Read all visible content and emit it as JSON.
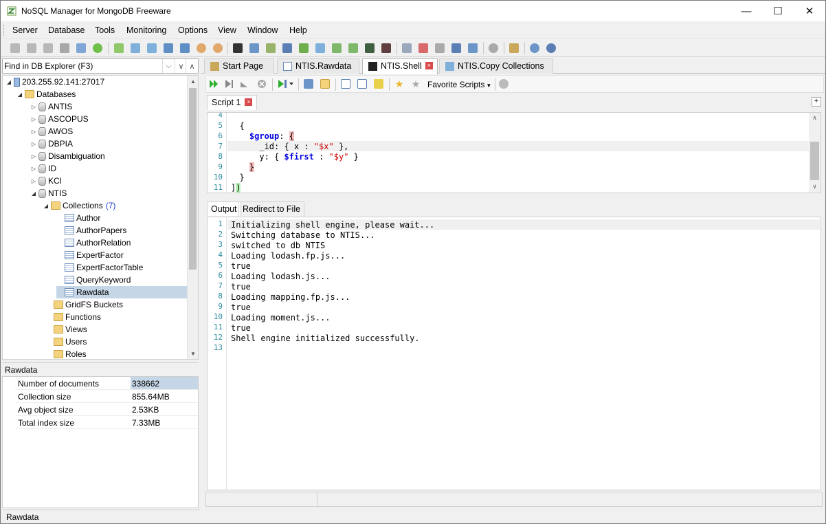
{
  "window": {
    "title": "NoSQL Manager for MongoDB Freeware"
  },
  "menu": [
    "Server",
    "Database",
    "Tools",
    "Monitoring",
    "Options",
    "View",
    "Window",
    "Help"
  ],
  "find": {
    "placeholder": "Find in DB Explorer (F3)"
  },
  "tree": {
    "server": "203.255.92.141:27017",
    "databases_label": "Databases",
    "databases": [
      "ANTIS",
      "ASCOPUS",
      "AWOS",
      "DBPIA",
      "Disambiguation",
      "ID",
      "KCI",
      "NTIS"
    ],
    "collections_label": "Collections",
    "collections_count": "(7)",
    "collections": [
      "Author",
      "AuthorPapers",
      "AuthorRelation",
      "ExpertFactor",
      "ExpertFactorTable",
      "QueryKeyword",
      "Rawdata"
    ],
    "other_folders": [
      "GridFS Buckets",
      "Functions",
      "Views",
      "Users",
      "Roles"
    ]
  },
  "properties": {
    "title": "Rawdata",
    "rows": [
      {
        "key": "Number of documents",
        "value": "338662"
      },
      {
        "key": "Collection size",
        "value": "855.64MB"
      },
      {
        "key": "Avg object size",
        "value": "2.53KB"
      },
      {
        "key": "Total index size",
        "value": "7.33MB"
      }
    ]
  },
  "tabs": [
    "Start Page",
    "NTIS.Rawdata",
    "NTIS.Shell",
    "NTIS.Copy Collections"
  ],
  "script_toolbar": {
    "favorite_scripts": "Favorite Scripts"
  },
  "script_tab": "Script 1",
  "editor": {
    "line_numbers": [
      "4",
      "5",
      "6",
      "7",
      "8",
      "9",
      "10",
      "11"
    ]
  },
  "output_tabs": [
    "Output",
    "Redirect to File"
  ],
  "output": [
    "Initializing shell engine, please wait...",
    "Switching database to NTIS...",
    "switched to db NTIS",
    "Loading lodash.fp.js...",
    "true",
    "Loading lodash.js...",
    "true",
    "Loading mapping.fp.js...",
    "true",
    "Loading moment.js...",
    "true",
    "Shell engine initialized successfully.",
    ""
  ],
  "output_line_numbers": [
    "1",
    "2",
    "3",
    "4",
    "5",
    "6",
    "7",
    "8",
    "9",
    "10",
    "11",
    "12",
    "13"
  ],
  "statusbar": {
    "left": "Rawdata"
  }
}
